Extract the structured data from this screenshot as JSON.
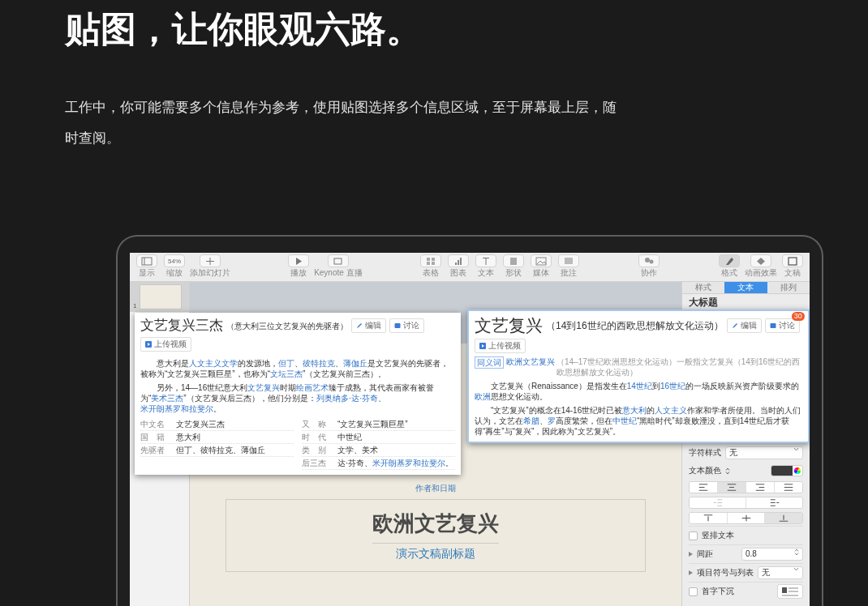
{
  "header": {
    "title": "贴图，让你眼观六路。",
    "description": "工作中，你可能需要多个信息作为参考，使用贴图选择多个信息区域，至于屏幕最上层，随时查阅。"
  },
  "toolbar": [
    [
      {
        "label": "显示",
        "kind": "view",
        "selected": false
      },
      {
        "label": "缩放",
        "kind": "zoom",
        "value": "54%",
        "selected": false
      },
      {
        "label": "添加幻灯片",
        "kind": "add",
        "selected": false
      }
    ],
    [
      {
        "label": "播放",
        "kind": "play",
        "selected": false
      },
      {
        "label": "Keynote 直播",
        "kind": "live",
        "selected": false
      }
    ],
    [
      {
        "label": "表格",
        "kind": "table",
        "selected": false
      },
      {
        "label": "图表",
        "kind": "chart",
        "selected": false
      },
      {
        "label": "文本",
        "kind": "text",
        "selected": false
      },
      {
        "label": "形状",
        "kind": "shape",
        "selected": false
      },
      {
        "label": "媒体",
        "kind": "media",
        "selected": false
      },
      {
        "label": "批注",
        "kind": "comment",
        "selected": false
      }
    ],
    [
      {
        "label": "协作",
        "kind": "collab",
        "selected": false
      }
    ],
    [
      {
        "label": "格式",
        "kind": "format",
        "selected": true
      },
      {
        "label": "动画效果",
        "kind": "animate",
        "selected": false
      },
      {
        "label": "文稿",
        "kind": "document",
        "selected": false
      }
    ]
  ],
  "thumbnails": [
    {
      "number": "1",
      "selected": true
    }
  ],
  "slide": {
    "author": "作者和日期",
    "title": "欧洲文艺复兴",
    "subtitle": "演示文稿副标题"
  },
  "sidebar": {
    "tabs": [
      {
        "label": "样式",
        "selected": false
      },
      {
        "label": "文本",
        "selected": true
      },
      {
        "label": "排列",
        "selected": false
      }
    ],
    "style": "大标题",
    "char_style": {
      "label": "字符样式",
      "value": "无"
    },
    "text_color": {
      "label": "文本颜色",
      "color": "#3a3a3a"
    },
    "align": [
      {
        "kind": "left",
        "selected": false
      },
      {
        "kind": "center",
        "selected": true
      },
      {
        "kind": "right",
        "selected": false
      },
      {
        "kind": "justify",
        "selected": false
      }
    ],
    "indent": [
      {
        "kind": "outdent",
        "disabled": true
      },
      {
        "kind": "indent",
        "disabled": false
      }
    ],
    "valign": [
      {
        "kind": "top",
        "selected": false
      },
      {
        "kind": "middle",
        "selected": false
      },
      {
        "kind": "bottom",
        "selected": true
      }
    ],
    "vertical_text": {
      "label": "竖排文本",
      "checked": false
    },
    "spacing": {
      "label": "间距",
      "value": "0.8",
      "expanded": false
    },
    "bullets": {
      "label": "项目符号与列表",
      "value": "无",
      "expanded": false
    },
    "drop_cap": {
      "label": "首字下沉",
      "checked": false
    }
  },
  "snips": [
    {
      "title": "文艺复兴三杰",
      "subtitle": "（意大利三位文艺复兴的先驱者）",
      "buttons": [
        {
          "label": "编辑",
          "kind": "edit"
        },
        {
          "label": "讨论",
          "kind": "discuss"
        }
      ],
      "upload": "上传视频",
      "paragraphs": [
        [
          {
            "text": "意大利是"
          },
          {
            "text": "人文主义文学",
            "link": true
          },
          {
            "text": "的发源地，"
          },
          {
            "text": "但丁",
            "link": true
          },
          {
            "text": "、"
          },
          {
            "text": "彼特拉克",
            "link": true
          },
          {
            "text": "、"
          },
          {
            "text": "薄伽丘",
            "link": true
          },
          {
            "text": "是文艺复兴的先驱者，被称为“文艺复兴三颗巨星”，也称为“"
          },
          {
            "text": "文坛三杰",
            "link": true
          },
          {
            "text": "”（文艺复兴前三杰）。"
          }
        ],
        [
          {
            "text": "另外，14—16世纪意大利"
          },
          {
            "text": "文艺复兴",
            "link": true
          },
          {
            "text": "时期"
          },
          {
            "text": "绘画艺术",
            "link": true
          },
          {
            "text": "臻于成熟，其代表画家有被誉为“"
          },
          {
            "text": "美术三杰",
            "link": true
          },
          {
            "text": "”（文艺复兴后三杰），他们分别是："
          },
          {
            "text": "列奥纳多·达·芬奇",
            "link": true
          },
          {
            "text": "、"
          },
          {
            "text": "米开朗基罗和拉斐尔",
            "link": true
          },
          {
            "text": "。"
          }
        ]
      ],
      "facts_left": [
        {
          "label": "中文名",
          "value": "文艺复兴三杰"
        },
        {
          "label": "国　籍",
          "value": "意大利"
        },
        {
          "label": "先驱者",
          "value": "但丁、彼特拉克、薄伽丘"
        }
      ],
      "facts_right": [
        {
          "label": "又　称",
          "value": "“文艺复兴三颗巨星”"
        },
        {
          "label": "时　代",
          "value": "中世纪"
        },
        {
          "label": "类　别",
          "value": "文学、美术"
        },
        {
          "label": "后三杰",
          "value": [
            {
              "text": "达·芬奇、"
            },
            {
              "text": "米开朗基罗和拉斐尔",
              "link": true
            },
            {
              "text": "。"
            }
          ]
        }
      ]
    },
    {
      "title": "文艺复兴",
      "subtitle": "（14到16世纪的西欧思想解放文化运动）",
      "buttons": [
        {
          "label": "编辑",
          "kind": "edit"
        },
        {
          "label": "讨论",
          "kind": "discuss",
          "badge": "30"
        }
      ],
      "upload": "上传视频",
      "synonym": {
        "tag": "同义词",
        "link": "欧洲文艺复兴",
        "text": "（14–17世纪欧洲思想文化运动）一般指文艺复兴（14到16世纪的西欧思想解放文化运动）"
      },
      "paragraphs": [
        [
          {
            "text": "文艺复兴（Renaissance）是指发生在"
          },
          {
            "text": "14世纪",
            "link": true
          },
          {
            "text": "到"
          },
          {
            "text": "16世纪",
            "link": true
          },
          {
            "text": "的一场反映新兴资产阶级要求的"
          },
          {
            "text": "欧洲",
            "link": true
          },
          {
            "text": "思想文化运动。"
          }
        ],
        [
          {
            "text": "“文艺复兴”的概念在14-16世纪时已被"
          },
          {
            "text": "意大利",
            "link": true
          },
          {
            "text": "的"
          },
          {
            "text": "人文主义",
            "link": true
          },
          {
            "text": "作家和学者所使用。当时的人们认为，文艺在"
          },
          {
            "text": "希腊",
            "link": true
          },
          {
            "text": "、"
          },
          {
            "text": "罗",
            "link": true
          },
          {
            "text": "高度繁荣，但在"
          },
          {
            "text": "中世纪",
            "link": true
          },
          {
            "text": "“黑暗时代”却衰败湮没，直到14世纪后才获得“再生”与“复兴”，因此称为“文艺复兴”。"
          }
        ]
      ]
    }
  ]
}
